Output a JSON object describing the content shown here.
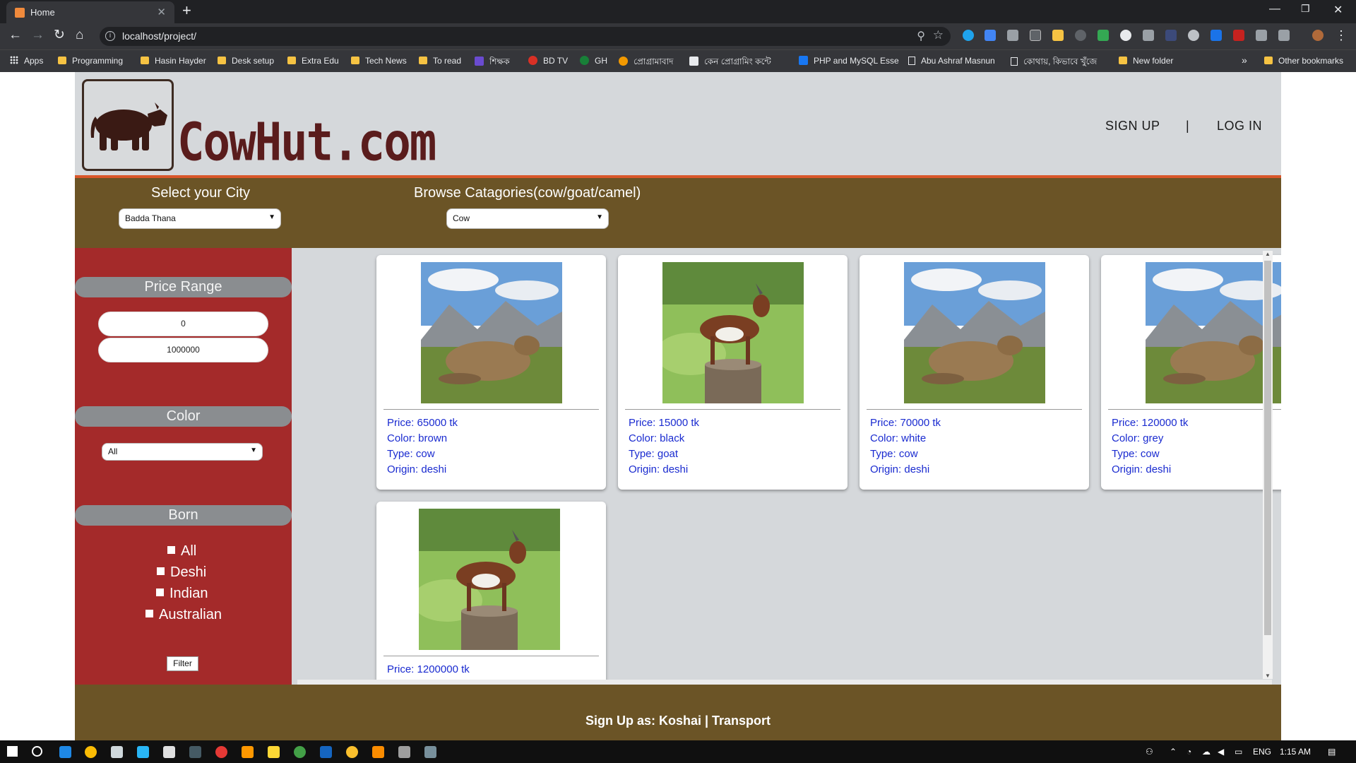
{
  "browser": {
    "tab_title": "Home",
    "url": "localhost/project/",
    "bookmarks": [
      "Apps",
      "Programming",
      "Hasin Hayder",
      "Desk setup",
      "Extra Edu",
      "Tech News",
      "To read",
      "শিক্ষক",
      "BD TV",
      "GH",
      "প্রোগ্রামাবাদ",
      "কেন প্রোগ্রামিং কন্টে",
      "PHP and MySQL Esse",
      "Abu Ashraf Masnun",
      "কোথায়, কিভাবে খুঁজে",
      "New folder"
    ],
    "other_bookmarks": "Other bookmarks"
  },
  "site": {
    "logo_text": "CowHut.com",
    "nav": {
      "signup": "SIGN UP",
      "separator": "|",
      "login": "LOG IN"
    },
    "filters": {
      "city_title": "Select your City",
      "city_value": "Badda Thana",
      "category_title": "Browse Catagories(cow/goat/camel)",
      "category_value": "Cow"
    },
    "sidebar": {
      "price_title": "Price Range",
      "price_min": "0",
      "price_max": "1000000",
      "color_title": "Color",
      "color_value": "All",
      "born_title": "Born",
      "born_options": [
        "All",
        "Deshi",
        "Indian",
        "Australian"
      ],
      "filter_button": "Filter"
    },
    "products": [
      {
        "image": "cow-photo",
        "price": "Price: 65000 tk",
        "color": "Color: brown",
        "type": "Type: cow",
        "origin": "Origin: deshi"
      },
      {
        "image": "goat-photo",
        "price": "Price: 15000 tk",
        "color": "Color: black",
        "type": "Type: goat",
        "origin": "Origin: deshi"
      },
      {
        "image": "cow-photo",
        "price": "Price: 70000 tk",
        "color": "Color: white",
        "type": "Type: cow",
        "origin": "Origin: deshi"
      },
      {
        "image": "cow-photo",
        "price": "Price: 120000 tk",
        "color": "Color: grey",
        "type": "Type: cow",
        "origin": "Origin: deshi"
      },
      {
        "image": "goat-photo",
        "price": "Price: 1200000 tk",
        "color": "",
        "type": "",
        "origin": ""
      }
    ],
    "footer": {
      "prefix": "Sign Up as: ",
      "koshai": "Koshai",
      "separator": " | ",
      "transport": "Transport"
    }
  },
  "taskbar": {
    "lang": "ENG",
    "time": "1:15 AM"
  },
  "colors": {
    "header_bg": "#d5d8db",
    "accent_line": "#d9572a",
    "filterbar_bg": "#6b5426",
    "sidebar_bg": "#a42a2a",
    "logo_text": "#5a1c1c",
    "product_text": "#1a2bd0"
  }
}
